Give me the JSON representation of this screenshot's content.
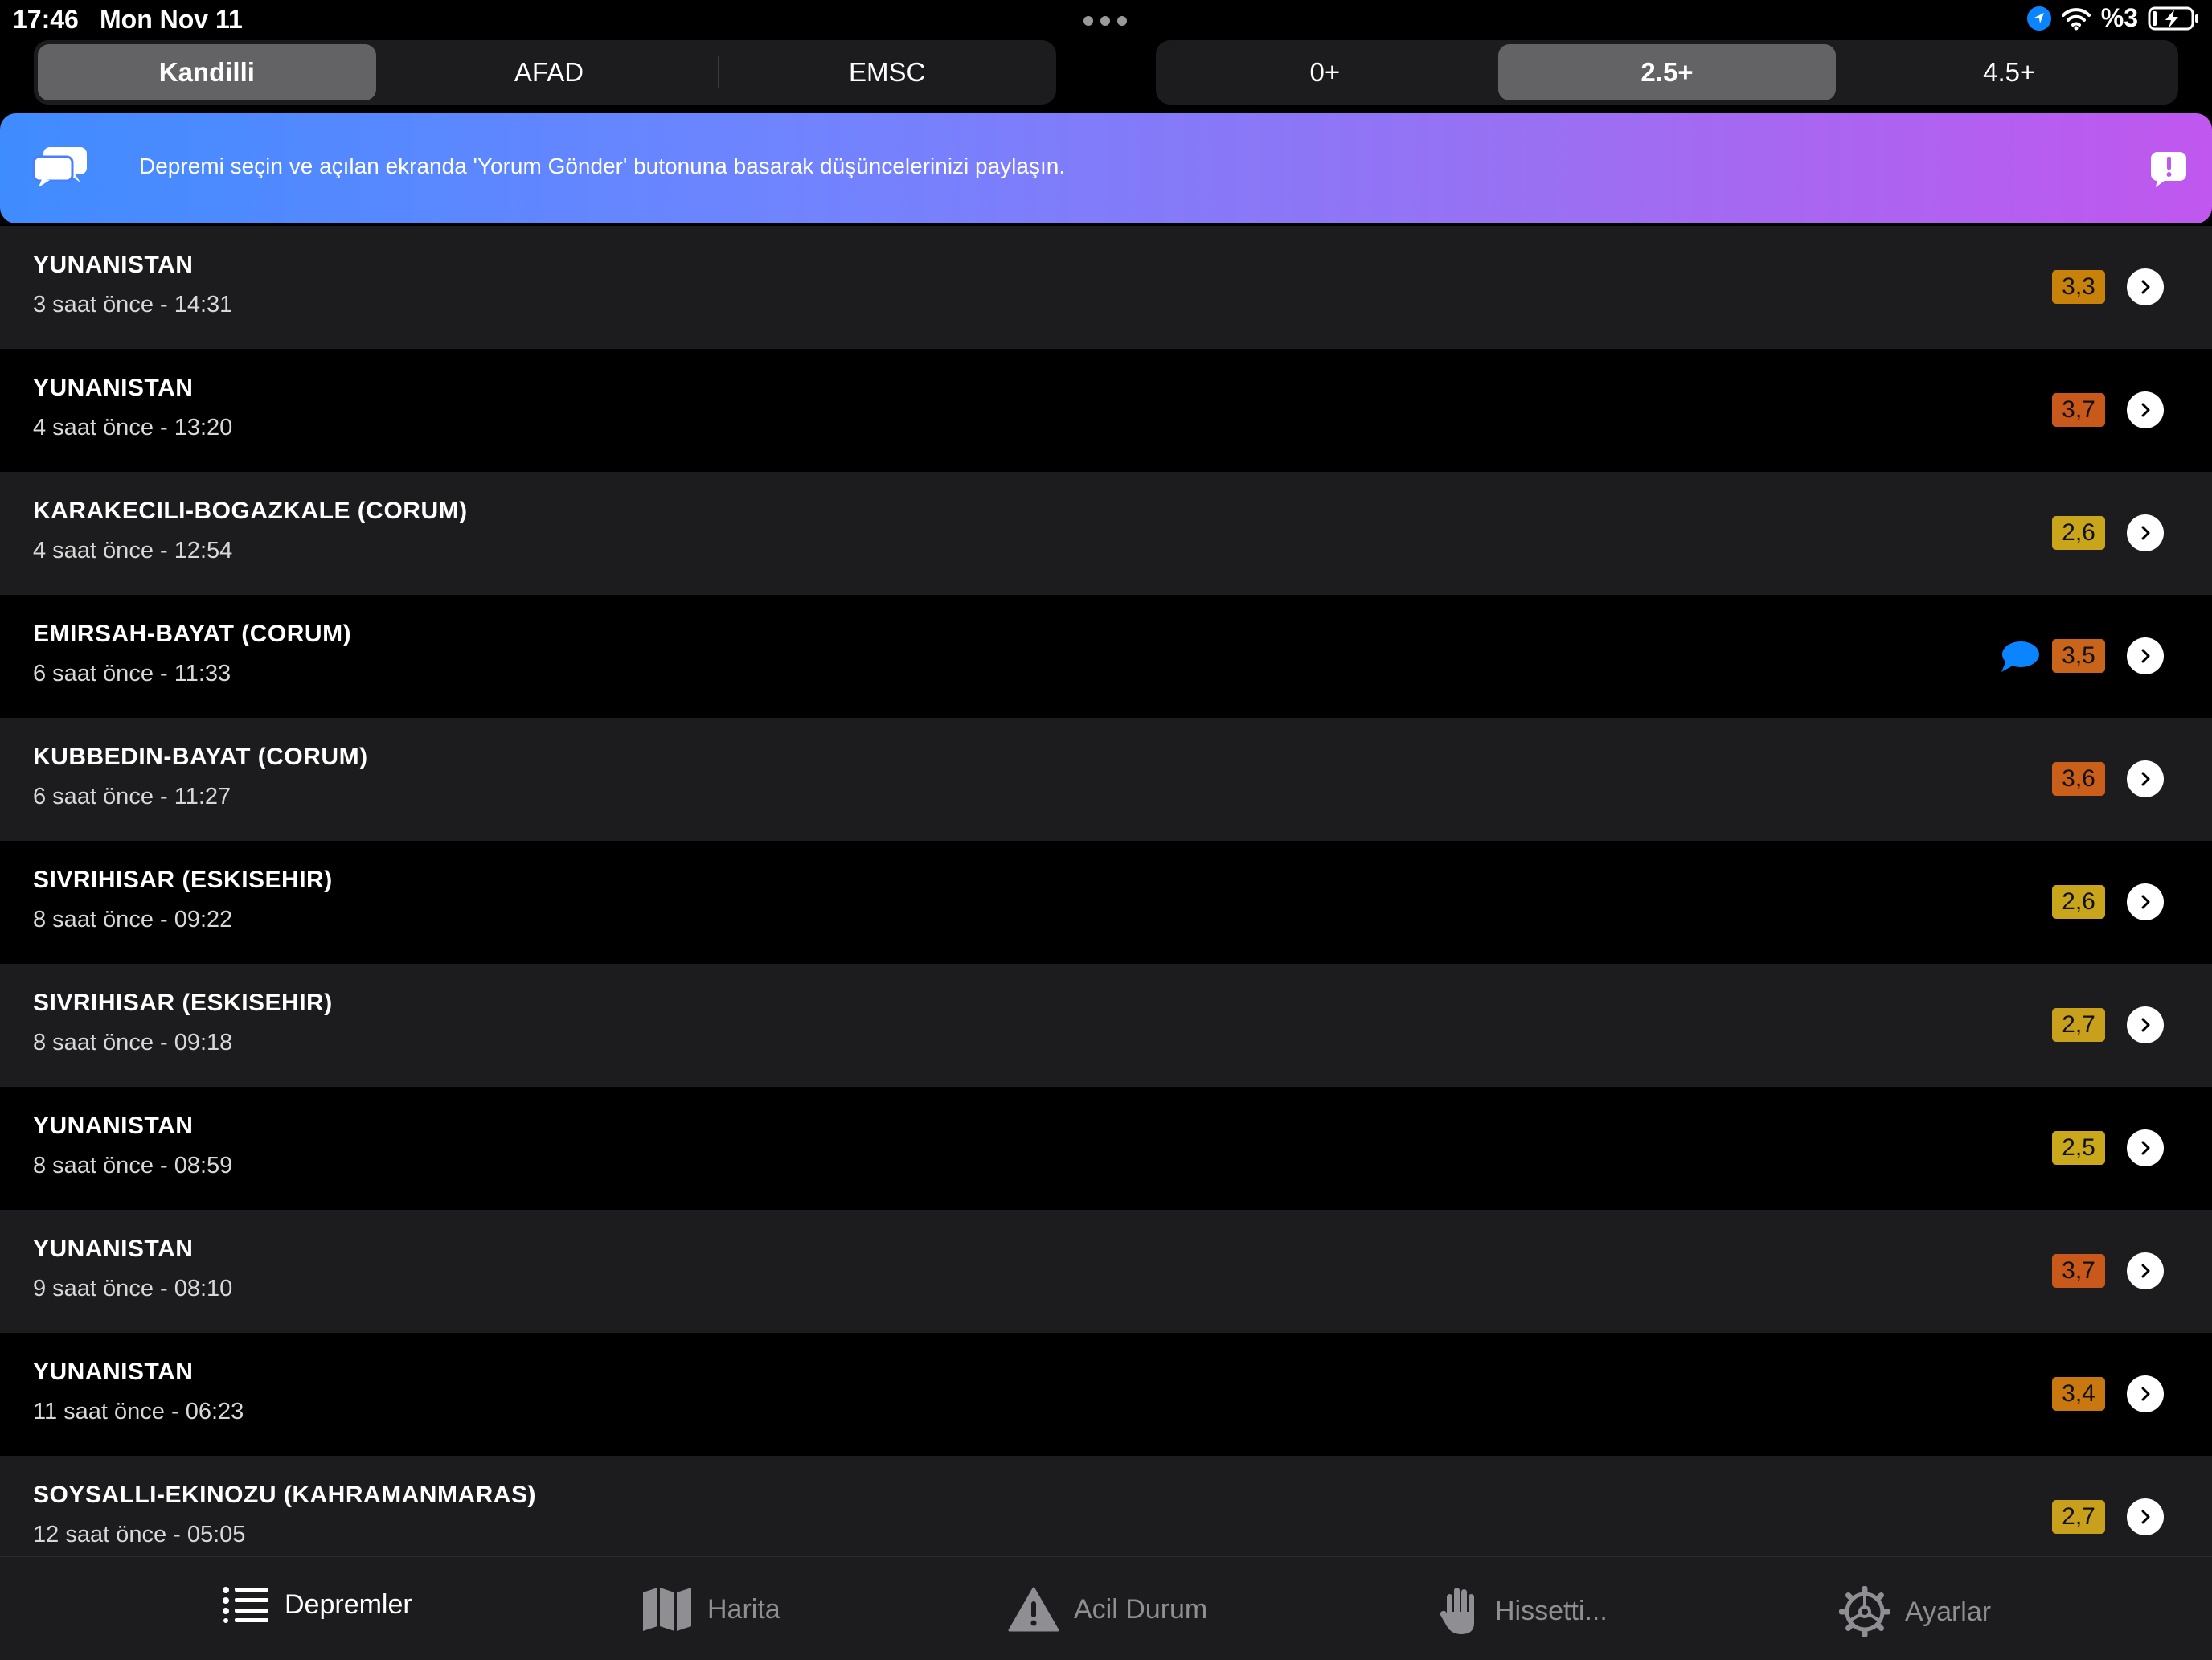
{
  "status_bar": {
    "time": "17:46",
    "date": "Mon Nov 11",
    "battery": "%3"
  },
  "source_tabs": [
    {
      "label": "Kandilli",
      "active": true
    },
    {
      "label": "AFAD",
      "active": false
    },
    {
      "label": "EMSC",
      "active": false
    }
  ],
  "magnitude_tabs": [
    {
      "label": "0+",
      "active": false
    },
    {
      "label": "2.5+",
      "active": true
    },
    {
      "label": "4.5+",
      "active": false
    }
  ],
  "banner": {
    "text": "Depremi seçin ve açılan ekranda 'Yorum Gönder' butonuna basarak düşüncelerinizi paylaşın.",
    "icon": "chat-bubbles-icon",
    "action_icon": "alert-bubble-icon"
  },
  "earthquakes": [
    {
      "location": "YUNANISTAN",
      "time": "3 saat önce - 14:31",
      "magnitude": "3,3",
      "color": "#c8820a",
      "has_comment": false
    },
    {
      "location": "YUNANISTAN",
      "time": "4 saat önce - 13:20",
      "magnitude": "3,7",
      "color": "#c9591a",
      "has_comment": false
    },
    {
      "location": "KARAKECILI-BOGAZKALE (CORUM)",
      "time": "4 saat önce - 12:54",
      "magnitude": "2,6",
      "color": "#c9a51c",
      "has_comment": false
    },
    {
      "location": "EMIRSAH-BAYAT (CORUM)",
      "time": "6 saat önce - 11:33",
      "magnitude": "3,5",
      "color": "#c9651a",
      "has_comment": true
    },
    {
      "location": "KUBBEDIN-BAYAT (CORUM)",
      "time": "6 saat önce - 11:27",
      "magnitude": "3,6",
      "color": "#c95f1a",
      "has_comment": false
    },
    {
      "location": "SIVRIHISAR (ESKISEHIR)",
      "time": "8 saat önce - 09:22",
      "magnitude": "2,6",
      "color": "#c9a51c",
      "has_comment": false
    },
    {
      "location": "SIVRIHISAR (ESKISEHIR)",
      "time": "8 saat önce - 09:18",
      "magnitude": "2,7",
      "color": "#c9a01c",
      "has_comment": false
    },
    {
      "location": "YUNANISTAN",
      "time": "8 saat önce - 08:59",
      "magnitude": "2,5",
      "color": "#c9a81c",
      "has_comment": false
    },
    {
      "location": "YUNANISTAN",
      "time": "9 saat önce - 08:10",
      "magnitude": "3,7",
      "color": "#c9591a",
      "has_comment": false
    },
    {
      "location": "YUNANISTAN",
      "time": "11 saat önce - 06:23",
      "magnitude": "3,4",
      "color": "#c8780f",
      "has_comment": false
    },
    {
      "location": "SOYSALLI-EKINOZU (KAHRAMANMARAS)",
      "time": "12 saat önce - 05:05",
      "magnitude": "2,7",
      "color": "#c9a01c",
      "has_comment": false
    }
  ],
  "tab_bar": [
    {
      "label": "Depremler",
      "icon": "list-icon",
      "active": true
    },
    {
      "label": "Harita",
      "icon": "map-icon",
      "active": false
    },
    {
      "label": "Acil Durum",
      "icon": "warning-icon",
      "active": false
    },
    {
      "label": "Hissetti...",
      "icon": "hand-icon",
      "active": false
    },
    {
      "label": "Ayarlar",
      "icon": "gear-icon",
      "active": false
    }
  ]
}
